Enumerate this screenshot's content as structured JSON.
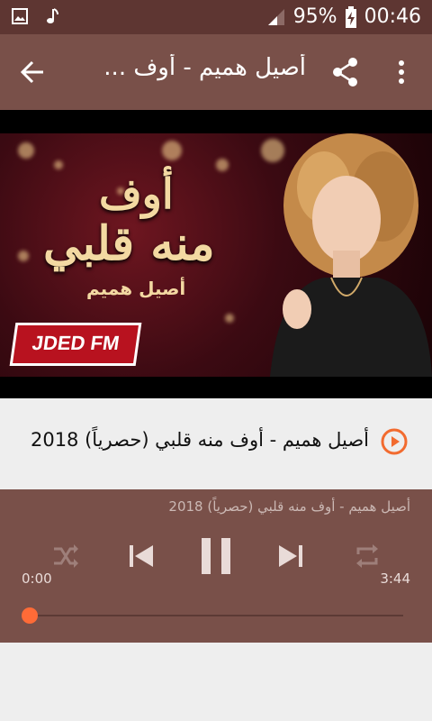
{
  "status": {
    "battery": "95%",
    "time": "00:46"
  },
  "appbar": {
    "title": "أصيل هميم - أوف ..."
  },
  "video": {
    "line1": "أوف",
    "line2": "منه قلبي",
    "line3": "أصيل هميم",
    "logo": "JDED FM"
  },
  "song": {
    "title": "أصيل هميم - أوف منه قلبي (حصرياً)  2018"
  },
  "player": {
    "title": "أصيل هميم - أوف منه قلبي (حصرياً)  2018",
    "elapsed": "0:00",
    "duration": "3:44",
    "progress": 0
  },
  "colors": {
    "appbar": "#795049",
    "statusbar": "#5e3632",
    "accent": "#ff6b37"
  }
}
